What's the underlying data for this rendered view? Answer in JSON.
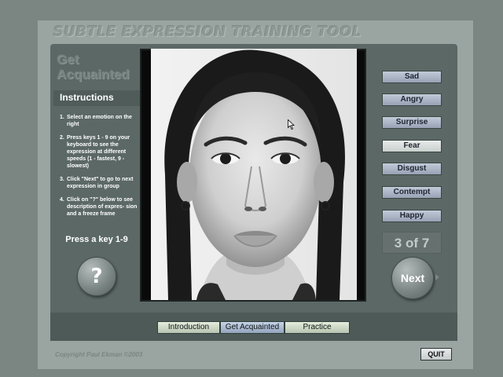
{
  "app": {
    "title": "SUBTLE EXPRESSION TRAINING TOOL"
  },
  "section": {
    "title_line1": "Get",
    "title_line2": "Acquainted"
  },
  "instructions": {
    "heading": "Instructions",
    "steps": [
      {
        "num": "1.",
        "text": "Select an emotion on the right"
      },
      {
        "num": "2.",
        "text": "Press keys 1 - 9 on your keyboard to see the expression at different speeds (1 - fastest, 9 - slowest)"
      },
      {
        "num": "3.",
        "text": "Click \"Next\" to go to next expression in group"
      },
      {
        "num": "4.",
        "text": "Click on \"?\" below to see description of expres- sion and a freeze frame"
      }
    ],
    "prompt": "Press a key 1-9"
  },
  "help_button": {
    "label": "?"
  },
  "emotions": [
    {
      "label": "Sad",
      "selected": false
    },
    {
      "label": "Angry",
      "selected": false
    },
    {
      "label": "Surprise",
      "selected": false
    },
    {
      "label": "Fear",
      "selected": true
    },
    {
      "label": "Disgust",
      "selected": false
    },
    {
      "label": "Contempt",
      "selected": false
    },
    {
      "label": "Happy",
      "selected": false
    }
  ],
  "counter": {
    "text": "3 of 7"
  },
  "next_button": {
    "label": "Next"
  },
  "tabs": [
    {
      "label": "Introduction",
      "active": false
    },
    {
      "label": "Get Acquainted",
      "active": true
    },
    {
      "label": "Practice",
      "active": false
    }
  ],
  "footer": {
    "copyright": "Copyright Paul Ekman ©2003",
    "quit_label": "QUIT"
  },
  "colors": {
    "panel": "#5b6866",
    "button_blue": "#97a2b5",
    "selected": "#e7ebe9"
  }
}
